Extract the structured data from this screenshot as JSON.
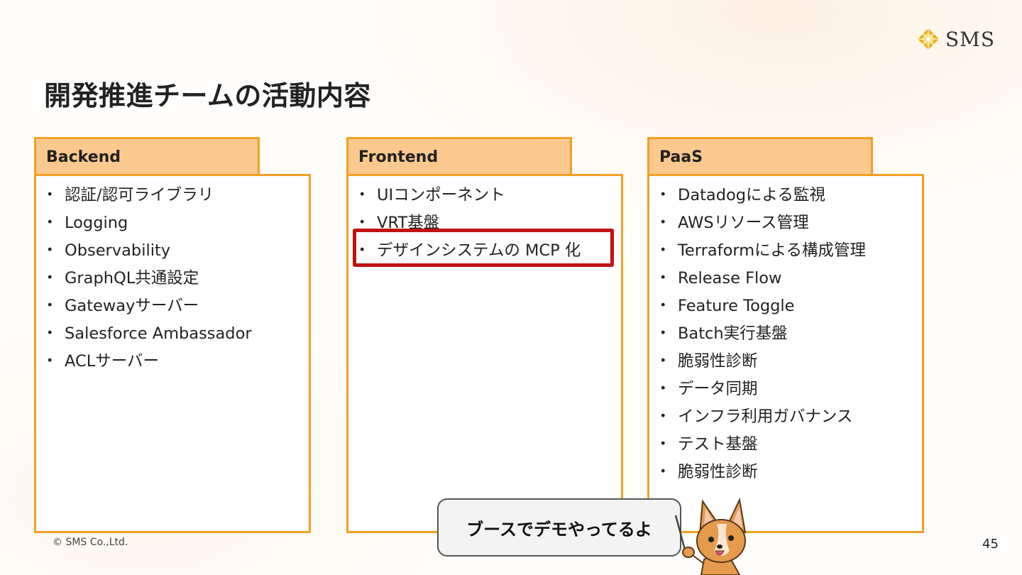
{
  "header": {
    "title": "開発推進チームの活動内容",
    "logo_text": "SMS"
  },
  "columns": [
    {
      "heading": "Backend",
      "items": [
        "認証/認可ライブラリ",
        "Logging",
        "Observability",
        "GraphQL共通設定",
        "Gatewayサーバー",
        "Salesforce Ambassador",
        "ACLサーバー"
      ]
    },
    {
      "heading": "Frontend",
      "items": [
        "UIコンポーネント",
        "VRT基盤",
        "デザインシステムの MCP 化"
      ]
    },
    {
      "heading": "PaaS",
      "items": [
        "Datadogによる監視",
        "AWSリソース管理",
        "Terraformによる構成管理",
        "Release Flow",
        "Feature Toggle",
        "Batch実行基盤",
        "脆弱性診断",
        "データ同期",
        "インフラ利用ガバナンス",
        "テスト基盤",
        "脆弱性診断"
      ]
    }
  ],
  "speech_bubble": "ブースでデモやってるよ",
  "footer": {
    "copyright": "© SMS Co.,Ltd.",
    "page_number": "45"
  },
  "colors": {
    "accent_border": "#f2a025",
    "heading_fill": "#fbc98e",
    "highlight": "#c01212",
    "logo_gold": "#e8b21e"
  }
}
